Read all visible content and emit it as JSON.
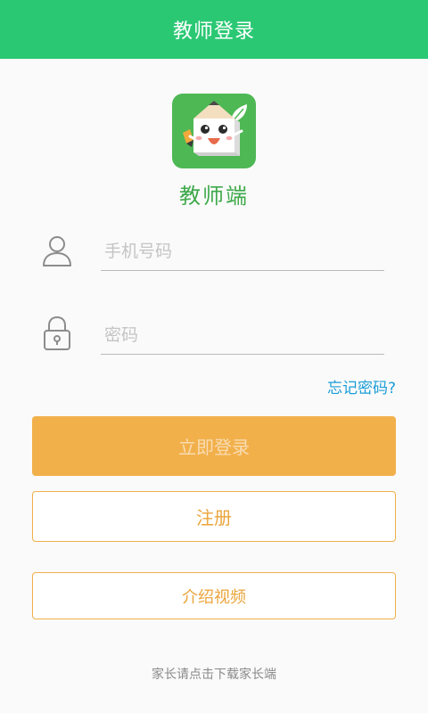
{
  "header": {
    "title": "教师登录"
  },
  "logo": {
    "icon": "mascot-pencil-icon",
    "bg_color": "#4db854"
  },
  "app_name": "教师端",
  "form": {
    "phone": {
      "placeholder": "手机号码",
      "value": "",
      "icon": "user-icon"
    },
    "password": {
      "placeholder": "密码",
      "value": "",
      "icon": "lock-icon"
    },
    "forgot_label": "忘记密码?"
  },
  "buttons": {
    "login_label": "立即登录",
    "register_label": "注册",
    "intro_label": "介绍视频"
  },
  "footer": {
    "parent_link": "家长请点击下载家长端"
  },
  "colors": {
    "header": "#2bc874",
    "accent_green": "#3ea94a",
    "primary_button": "#f2b04b",
    "outline": "#f0b04a",
    "link": "#1a9ed8"
  }
}
